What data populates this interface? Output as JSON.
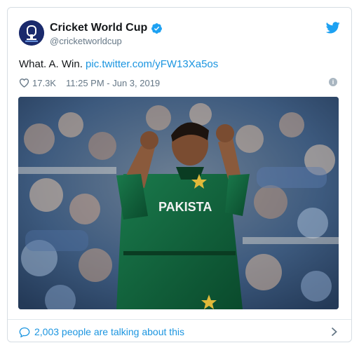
{
  "account": {
    "display_name": "Cricket World Cup",
    "handle": "@cricketworldcup"
  },
  "tweet": {
    "text": "What. A. Win.",
    "link": "pic.twitter.com/yFW13Xa5os"
  },
  "meta": {
    "likes": "17.3K",
    "timestamp": "11:25 PM - Jun 3, 2019"
  },
  "footer": {
    "conversation": "2,003 people are talking about this"
  },
  "photo": {
    "jersey_text": "PAKISTA"
  },
  "colors": {
    "link": "#1b95e0",
    "jersey": "#0f5f3c",
    "crowd": "#3d5f8a"
  }
}
